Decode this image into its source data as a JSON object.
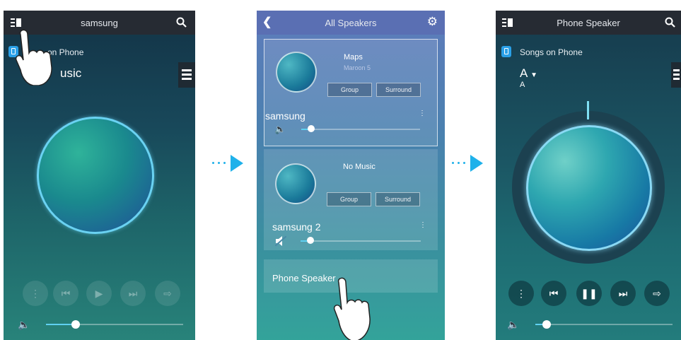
{
  "screen1": {
    "title": "samsung",
    "source_label": "Songs on Phone",
    "source_label_partial": "on Phone",
    "track_title_partial": "usic",
    "controls": [
      "more-icon",
      "previous-icon",
      "play-icon",
      "next-icon",
      "connect-icon"
    ],
    "volume": 0.2
  },
  "screen2": {
    "title": "All Speakers",
    "groups": [
      {
        "track": "Maps",
        "artist": "Maroon 5",
        "group_label": "Group",
        "surround_label": "Surround",
        "speaker_name": "samsung",
        "volume": 0.05,
        "muted": false
      },
      {
        "track": "No Music",
        "group_label": "Group",
        "surround_label": "Surround",
        "speaker_name": "samsung 2",
        "volume": 0.05,
        "muted": true
      }
    ],
    "phone_speaker_label": "Phone Speaker"
  },
  "screen3": {
    "title": "Phone Speaker",
    "source_label": "Songs on Phone",
    "track_title": "A",
    "artist": "A",
    "controls": [
      "more-icon",
      "previous-icon",
      "pause-icon",
      "next-icon",
      "connect-icon"
    ],
    "volume": 0.07
  },
  "colors": {
    "accent": "#1fb1ea",
    "badge": "#2aa0e8",
    "fill": "#5fd0f0"
  }
}
